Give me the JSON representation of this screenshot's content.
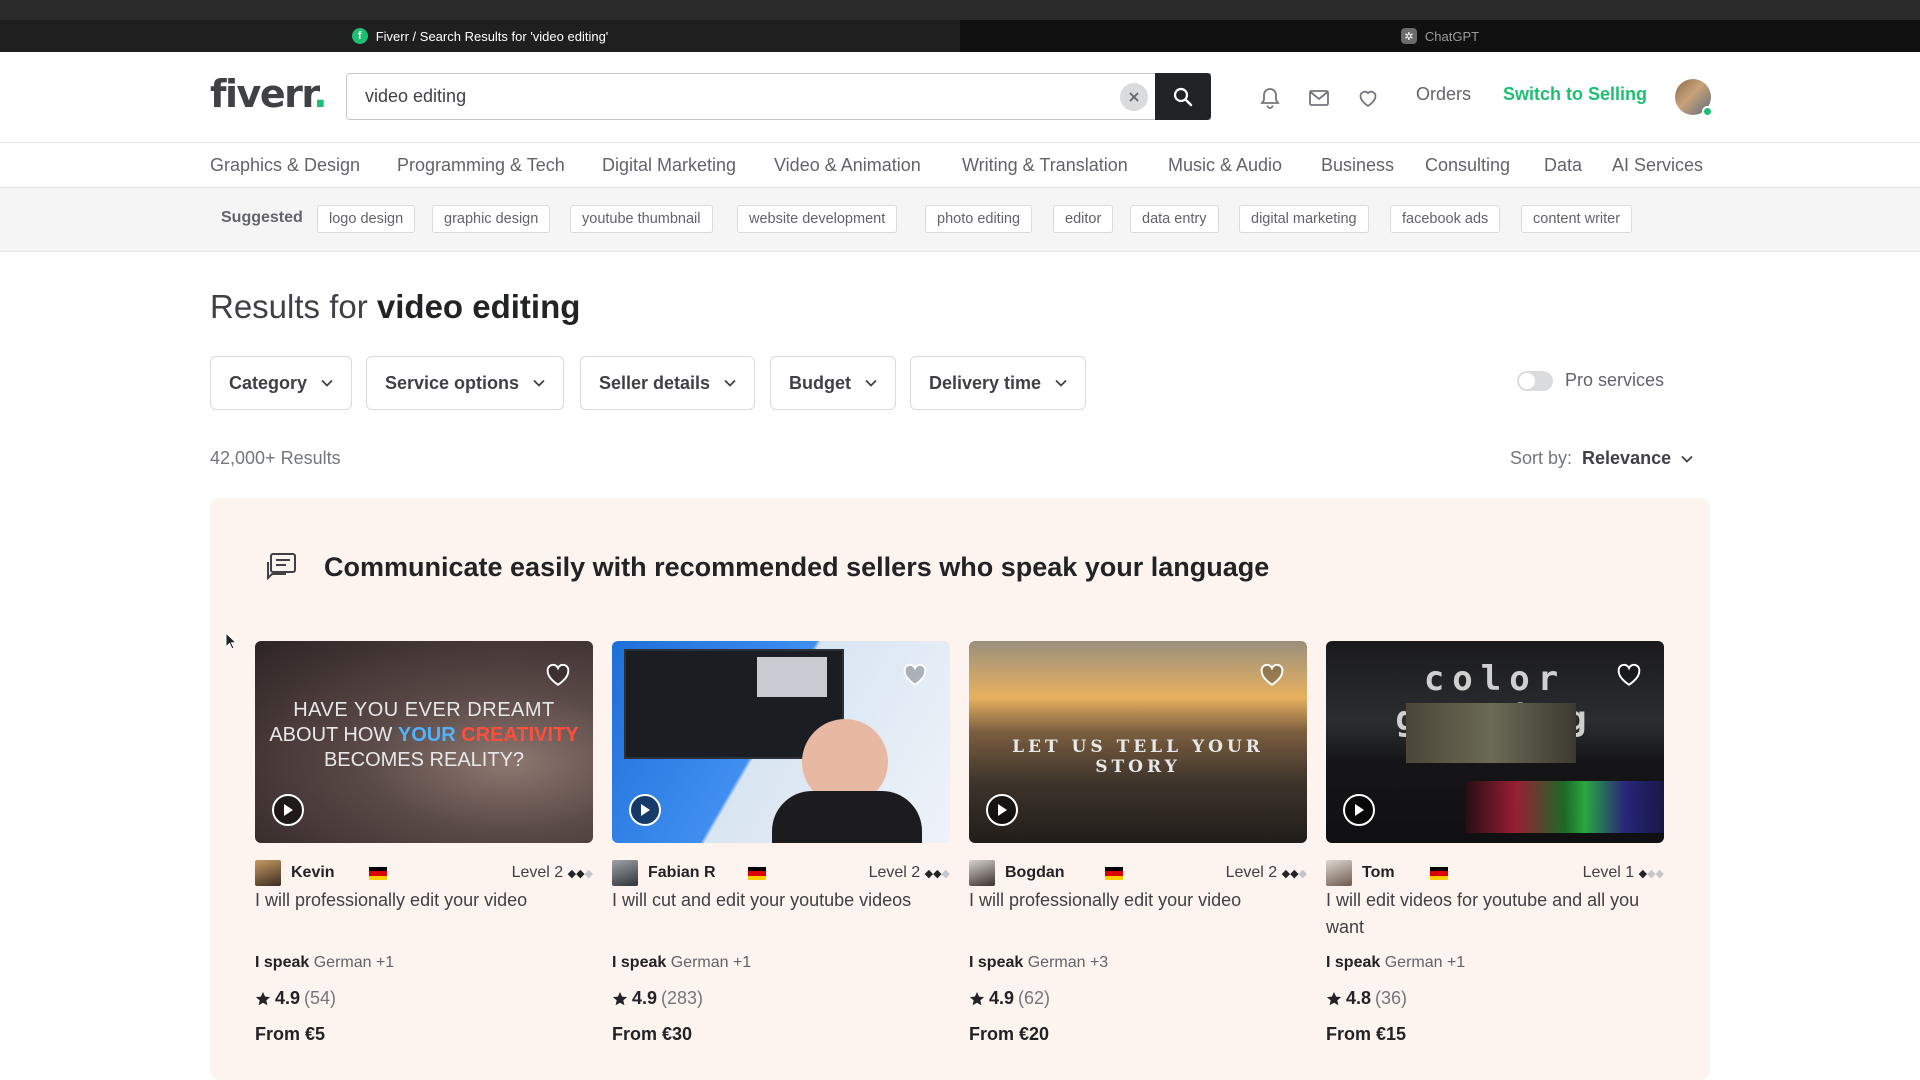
{
  "browser": {
    "active_tab": {
      "favicon": "fiverr-icon",
      "title": "Fiverr / Search Results for 'video editing'"
    },
    "inactive_tab": {
      "favicon": "chatgpt-icon",
      "title": "ChatGPT"
    }
  },
  "header": {
    "logo_text": "fiverr",
    "logo_dot": ".",
    "search_value": "video editing",
    "icons": [
      "bell-icon",
      "envelope-icon",
      "heart-icon"
    ],
    "orders_label": "Orders",
    "switch_label": "Switch to Selling"
  },
  "categories": [
    "Graphics & Design",
    "Programming & Tech",
    "Digital Marketing",
    "Video & Animation",
    "Writing & Translation",
    "Music & Audio",
    "Business",
    "Consulting",
    "Data",
    "AI Services"
  ],
  "suggested": {
    "label": "Suggested",
    "chips": [
      "logo design",
      "graphic design",
      "youtube thumbnail",
      "website development",
      "photo editing",
      "editor",
      "data entry",
      "digital marketing",
      "facebook ads",
      "content writer"
    ]
  },
  "results": {
    "prefix": "Results for",
    "query": "video editing",
    "count": "42,000+ Results",
    "sort_label": "Sort by:",
    "sort_value": "Relevance",
    "pro_label": "Pro services",
    "pro_enabled": false
  },
  "filters": [
    "Category",
    "Service options",
    "Seller details",
    "Budget",
    "Delivery time"
  ],
  "recommend": {
    "title": "Communicate easily with recommended sellers who speak your language",
    "speak_label": "I speak",
    "price_prefix": "From",
    "cards": [
      {
        "seller": "Kevin",
        "level": "Level 2",
        "level_filled": 2,
        "title": "I will professionally edit your video",
        "languages": "German +1",
        "rating": "4.9",
        "reviews": "(54)",
        "price": "€5",
        "thumb_text_1": "HAVE YOU EVER DREAMT",
        "thumb_text_2a": "ABOUT HOW ",
        "thumb_text_2b": "YOUR ",
        "thumb_text_2c": "CREATIVITY",
        "thumb_text_3": "BECOMES REALITY?"
      },
      {
        "seller": "Fabian R",
        "level": "Level 2",
        "level_filled": 2,
        "title": "I will cut and edit your youtube videos",
        "languages": "German +1",
        "rating": "4.9",
        "reviews": "(283)",
        "price": "€30"
      },
      {
        "seller": "Bogdan",
        "level": "Level 2",
        "level_filled": 2,
        "title": "I will professionally edit your video",
        "languages": "German +3",
        "rating": "4.9",
        "reviews": "(62)",
        "price": "€20",
        "thumb_text_1": "LET US TELL YOUR STORY"
      },
      {
        "seller": "Tom",
        "level": "Level 1",
        "level_filled": 1,
        "title": "I will edit videos for youtube and all you want",
        "languages": "German +1",
        "rating": "4.8",
        "reviews": "(36)",
        "price": "€15",
        "thumb_text_1": "color grading"
      }
    ]
  },
  "colors": {
    "brand_green": "#1dbf73",
    "panel_bg": "#fdf3ef",
    "text_dark": "#222325"
  }
}
